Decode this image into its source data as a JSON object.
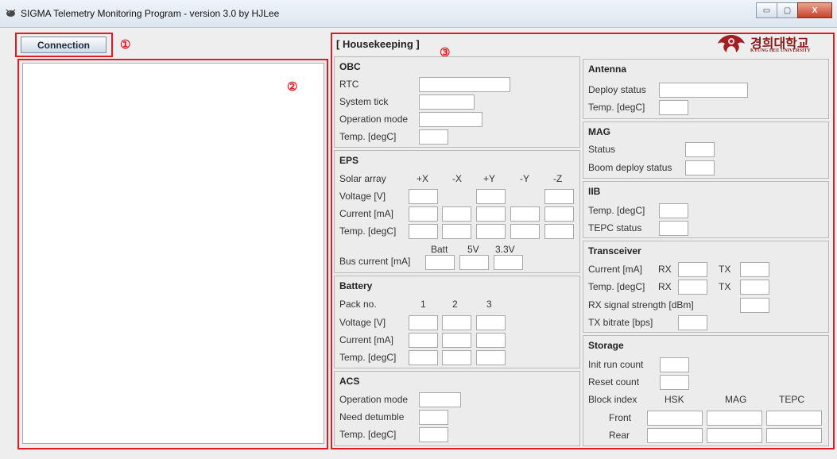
{
  "window": {
    "title": "SIGMA Telemetry Monitoring Program - version 3.0 by HJLee",
    "minimize": "▭",
    "maximize": "▢",
    "close": "X"
  },
  "annotations": {
    "one": "①",
    "two": "②",
    "three": "③"
  },
  "connection": {
    "button_label": "Connection"
  },
  "log": {
    "value": ""
  },
  "housekeeping": {
    "title": "[ Housekeeping ]",
    "logo_text": "경희대학교",
    "logo_sub": "KYUNG HEE UNIVERSITY"
  },
  "obc": {
    "title": "OBC",
    "rtc": "RTC",
    "system_tick": "System tick",
    "operation_mode": "Operation mode",
    "temp": "Temp. [degC]"
  },
  "eps": {
    "title": "EPS",
    "solar_array": "Solar array",
    "cols": [
      "+X",
      "-X",
      "+Y",
      "-Y",
      "-Z"
    ],
    "voltage": "Voltage [V]",
    "current": "Current [mA]",
    "temp": "Temp. [degC]",
    "bus_cols": [
      "Batt",
      "5V",
      "3.3V"
    ],
    "bus_current": "Bus current [mA]"
  },
  "battery": {
    "title": "Battery",
    "pack_no": "Pack no.",
    "cols": [
      "1",
      "2",
      "3"
    ],
    "voltage": "Voltage [V]",
    "current": "Current [mA]",
    "temp": "Temp. [degC]"
  },
  "acs": {
    "title": "ACS",
    "operation_mode": "Operation mode",
    "need_detumble": "Need detumble",
    "temp": "Temp. [degC]"
  },
  "antenna": {
    "title": "Antenna",
    "deploy_status": "Deploy status",
    "temp": "Temp. [degC]"
  },
  "mag": {
    "title": "MAG",
    "status": "Status",
    "boom_deploy_status": "Boom deploy status"
  },
  "iib": {
    "title": "IIB",
    "temp": "Temp. [degC]",
    "tepc_status": "TEPC status"
  },
  "transceiver": {
    "title": "Transceiver",
    "current": "Current [mA]",
    "temp": "Temp. [degC]",
    "rx": "RX",
    "tx": "TX",
    "rx_signal": "RX signal strength [dBm]",
    "tx_bitrate": "TX bitrate [bps]"
  },
  "storage": {
    "title": "Storage",
    "init_run_count": "Init run count",
    "reset_count": "Reset count",
    "block_index": "Block index",
    "cols": [
      "HSK",
      "MAG",
      "TEPC"
    ],
    "front": "Front",
    "rear": "Rear"
  }
}
